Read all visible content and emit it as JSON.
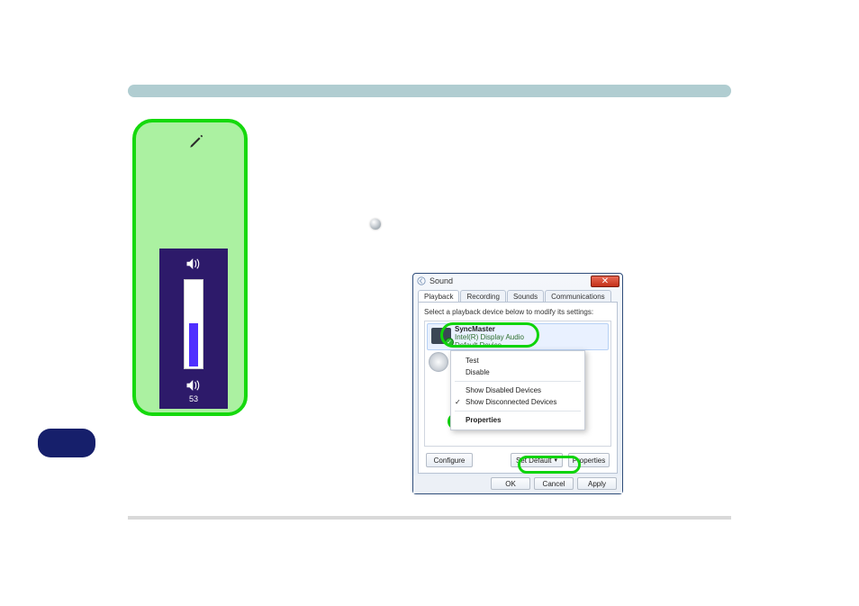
{
  "theme": {
    "tip_bar": "#b0cdd1",
    "panel_green": "#abf1a1",
    "panel_border": "#15d90d",
    "vol_bg": "#2d1a6a",
    "vol_fill": "#4f2fff",
    "badge": "#161f6b",
    "oval": "#0fd40a"
  },
  "volume": {
    "value_label": "53",
    "fill_percent": 50
  },
  "sound_dialog": {
    "title": "Sound",
    "close_label": "✕",
    "tabs": {
      "playback": "Playback",
      "recording": "Recording",
      "sounds": "Sounds",
      "communications": "Communications"
    },
    "instruction": "Select a playback device below to modify its settings:",
    "device1": {
      "name": "SyncMaster",
      "line2": "Intel(R) Display Audio",
      "line3": "Default Device"
    },
    "context_menu": {
      "test": "Test",
      "disable": "Disable",
      "show_disabled": "Show Disabled Devices",
      "show_disconnected": "Show Disconnected Devices",
      "properties": "Properties"
    },
    "buttons": {
      "configure": "Configure",
      "set_default": "Set Default",
      "properties": "Properties",
      "ok": "OK",
      "cancel": "Cancel",
      "apply": "Apply"
    }
  }
}
